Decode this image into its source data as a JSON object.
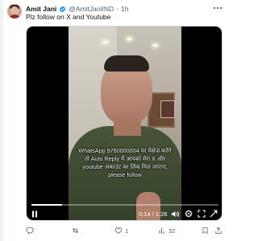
{
  "post": {
    "author_name": "Amit Jani",
    "handle": "@AmitJaniIND",
    "separator": "·",
    "time_ago": "1h",
    "text": "Plz follow on X and Youtube",
    "more_icon": "more-horizontal-icon"
  },
  "video": {
    "caption_lines": [
      "WhatsApp 9760000004 पर मेसेज करेंगे",
      "तो Auto Reply में आपको मेरा X और",
      "youtube अकाउंट का लिंक मिल जाएगा,",
      "please follow"
    ],
    "current_time": "0:14",
    "duration": "1:26",
    "time_separator": " / ",
    "progress_fraction": 0.163,
    "icons": [
      "play-icon",
      "volume-icon",
      "settings-icon",
      "fullscreen-icon"
    ]
  },
  "actions": {
    "reply_count": "",
    "repost_count": "",
    "like_count": "1",
    "views_count": "32",
    "icons": [
      "reply-icon",
      "repost-icon",
      "like-icon",
      "views-icon",
      "bookmark-icon",
      "share-icon"
    ]
  },
  "colors": {
    "verified_blue": "#1d9bf0",
    "secondary_text": "#536471"
  }
}
